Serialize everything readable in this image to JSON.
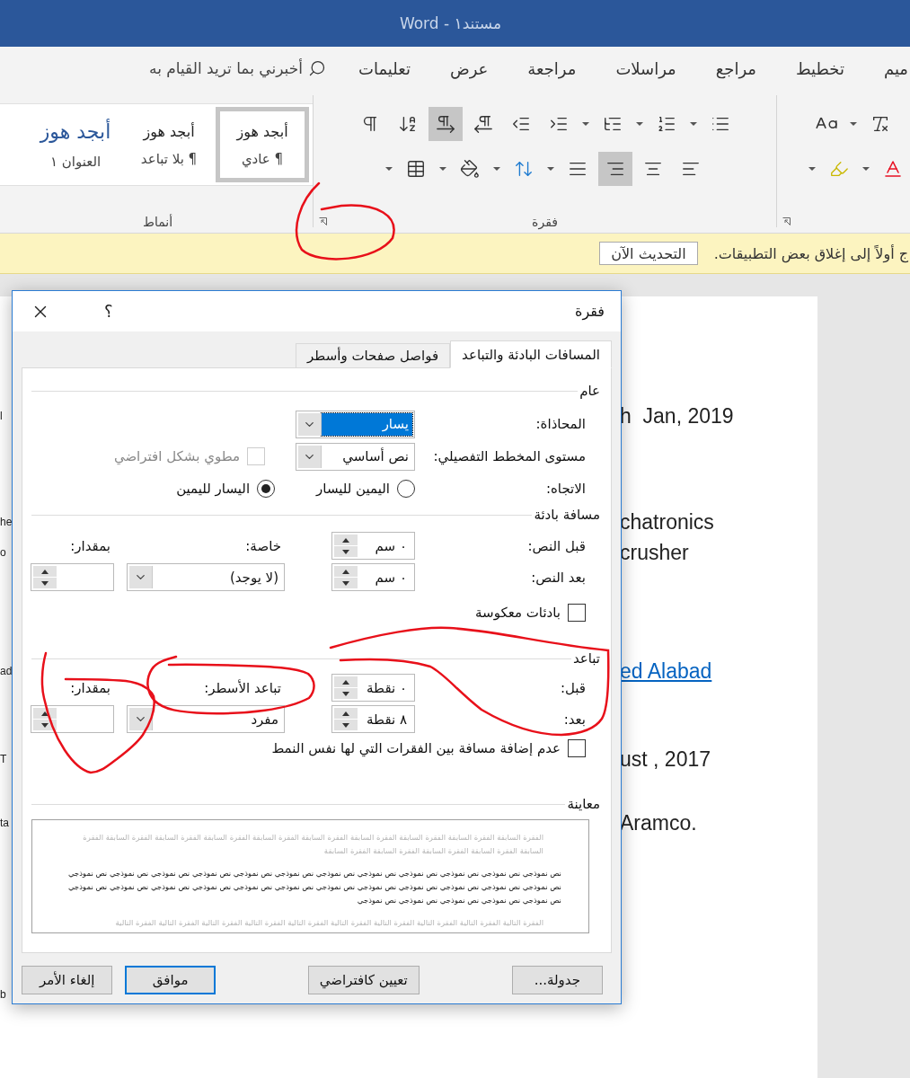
{
  "window": {
    "title": "Word - مستند١"
  },
  "ribbon_tabs": [
    "ميم",
    "تخطيط",
    "مراجع",
    "مراسلات",
    "مراجعة",
    "عرض",
    "تعليمات"
  ],
  "tell_me": {
    "placeholder": "أخبرني بما تريد القيام به"
  },
  "paragraph_group": {
    "label": "فقرة",
    "row_1": [
      {
        "kind": "bullets",
        "selected": false
      },
      {
        "kind": "numbering",
        "selected": false
      },
      {
        "kind": "multilevel",
        "selected": false
      },
      {
        "kind": "indent-right",
        "selected": false
      },
      {
        "kind": "indent-left",
        "selected": false
      },
      {
        "kind": "mark-arrow-left",
        "selected": false
      },
      {
        "kind": "mark-arrow-right",
        "selected": true
      },
      {
        "kind": "sort",
        "selected": false
      },
      {
        "kind": "pilcrow",
        "selected": false
      }
    ],
    "row_2": [
      {
        "kind": "align-left",
        "selected": false
      },
      {
        "kind": "align-center",
        "selected": false
      },
      {
        "kind": "align-right",
        "selected": true
      },
      {
        "kind": "justify",
        "selected": false
      },
      {
        "kind": "line-spacing",
        "selected": false
      },
      {
        "kind": "shading",
        "selected": false
      },
      {
        "kind": "borders",
        "selected": false
      }
    ]
  },
  "styles_group": {
    "label": "أنماط",
    "styles": [
      {
        "kind": "normal",
        "sample": "أبجد هوز",
        "name": "¶ عادي",
        "selected": true
      },
      {
        "kind": "normal",
        "sample": "أبجد هوز",
        "name": "¶ بلا تباعد",
        "selected": false
      },
      {
        "kind": "heading",
        "sample": "أبجد هوز",
        "name": "العنوان ١",
        "selected": false
      }
    ]
  },
  "info_bar": {
    "message": "ج أولاً إلى إغلاق بعض التطبيقات.",
    "button": "التحديث الآن"
  },
  "document": {
    "lines": [
      {
        "left": "l",
        "right": "h  Jan, 2019"
      },
      {
        "left": "he",
        "right": "chatronics"
      },
      {
        "left": "o",
        "right": "crusher"
      },
      {
        "left": "ad",
        "right": "ed Alabad",
        "link": true
      },
      {
        "left": "T",
        "right": "ust , 2017"
      },
      {
        "left": "ta",
        "right": "Aramco."
      },
      {
        "left": "b"
      }
    ]
  },
  "dialog": {
    "title": "فقرة",
    "help": "؟",
    "tabs": [
      {
        "label": "المسافات البادئة والتباعد",
        "selected": true
      },
      {
        "label": "فواصل صفحات وأسطر",
        "selected": false
      }
    ],
    "general": {
      "heading": "عام",
      "alignment": {
        "label": "المحاذاة:",
        "value": "يسار",
        "focused": true
      },
      "outline_level": {
        "label": "مستوى المخطط التفصيلي:",
        "value": "نص أساسي",
        "focused": false
      },
      "collapsed": {
        "label": "مطوي بشكل افتراضي",
        "checked": false,
        "disabled": true
      },
      "direction": {
        "label": "الاتجاه:",
        "options": [
          {
            "label": "اليمين لليسار",
            "selected": false
          },
          {
            "label": "اليسار لليمين",
            "selected": true
          }
        ]
      }
    },
    "indentation": {
      "heading": "مسافة بادئة",
      "before": {
        "label": "قبل النص:",
        "value": "٠ سم"
      },
      "after": {
        "label": "بعد النص:",
        "value": "٠ سم"
      },
      "special": {
        "label": "خاصة:",
        "value": "(لا يوجد)",
        "focused": false
      },
      "by": {
        "label": "بمقدار:"
      },
      "mirror": {
        "label": "بادئات معكوسة",
        "checked": false,
        "disabled": false
      }
    },
    "spacing": {
      "heading": "تباعد",
      "before": {
        "label": "قبل:",
        "value": "٠ نقطة"
      },
      "after": {
        "label": "بعد:",
        "value": "٨ نقطة"
      },
      "line_spacing": {
        "label": "تباعد الأسطر:",
        "value": "مفرد",
        "focused": false
      },
      "at": {
        "label": "بمقدار:"
      },
      "dont_add": {
        "label": "عدم إضافة مسافة بين الفقرات التي لها نفس النمط",
        "checked": false,
        "disabled": false
      }
    },
    "preview": {
      "heading": "معاينة",
      "previous": "الفقرة السابقة الفقرة السابقة الفقرة السابقة الفقرة السابقة الفقرة السابقة الفقرة السابقة الفقرة السابقة الفقرة السابقة الفقرة السابقة الفقرة السابقة الفقرة السابقة الفقرة السابقة الفقرة السابقة الفقرة السابقة",
      "sample": "نص نموذجي نص نموذجي نص نموذجي نص نموذجي نص نموذجي نص نموذجي نص نموذجي نص نموذجي نص نموذجي نص نموذجي نص نموذجي نص نموذجي نص نموذجي نص نموذجي نص نموذجي نص نموذجي نص نموذجي نص نموذجي نص نموذجي نص نموذجي نص نموذجي نص نموذجي نص نموذجي نص نموذجي نص نموذجي نص نموذجي نص نموذجي نص نموذجي نص نموذجي",
      "next": "الفقرة التالية الفقرة التالية الفقرة التالية الفقرة التالية الفقرة التالية الفقرة التالية الفقرة التالية الفقرة التالية الفقرة التالية الفقرة التالية"
    },
    "buttons": [
      {
        "label": "جدولة...",
        "default": false
      },
      {
        "label": "تعيين كافتراضي",
        "default": false
      },
      {
        "label": "موافق",
        "default": true
      },
      {
        "label": "إلغاء الأمر",
        "default": false
      }
    ]
  }
}
